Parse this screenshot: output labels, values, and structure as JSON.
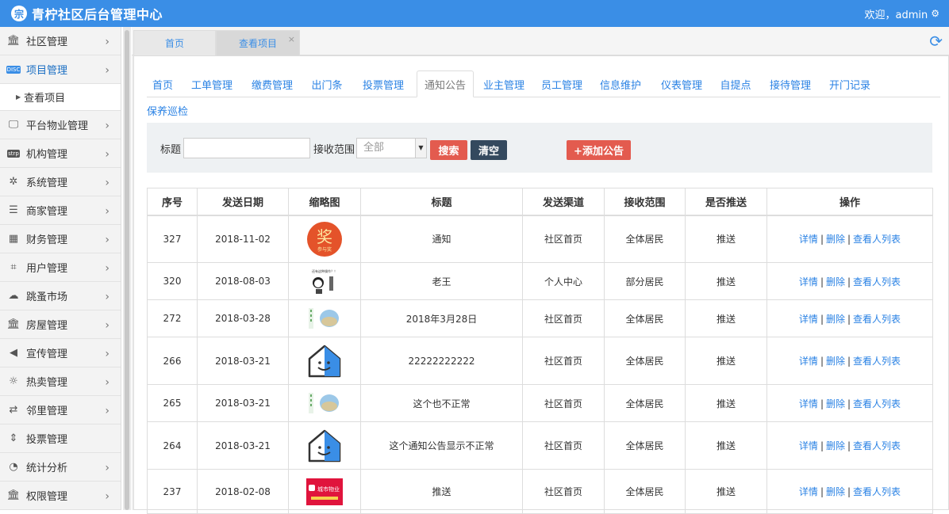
{
  "app": {
    "title": "青柠社区后台管理中心",
    "logo_glyph": "宗",
    "welcome": "欢迎，admin",
    "accent": "#3a8ee6"
  },
  "sidebar": {
    "items": [
      {
        "label": "社区管理",
        "icon": "bank-icon"
      },
      {
        "label": "项目管理",
        "icon": "discover-card-icon"
      },
      {
        "label": "平台物业管理",
        "icon": "monitor-icon"
      },
      {
        "label": "机构管理",
        "icon": "stripe-icon"
      },
      {
        "label": "系统管理",
        "icon": "yelp-icon"
      },
      {
        "label": "商家管理",
        "icon": "list-icon"
      },
      {
        "label": "财务管理",
        "icon": "calculator-icon"
      },
      {
        "label": "用户管理",
        "icon": "crop-icon"
      },
      {
        "label": "跳蚤市场",
        "icon": "cloud-icon"
      },
      {
        "label": "房屋管理",
        "icon": "bank-icon"
      },
      {
        "label": "宣传管理",
        "icon": "volume-icon"
      },
      {
        "label": "热卖管理",
        "icon": "sun-icon"
      },
      {
        "label": "邻里管理",
        "icon": "retweet-icon"
      },
      {
        "label": "投票管理",
        "icon": "sort-icon"
      },
      {
        "label": "统计分析",
        "icon": "pie-chart-icon"
      },
      {
        "label": "权限管理",
        "icon": "bank-icon"
      }
    ],
    "sub_item": "查看项目"
  },
  "tabs": [
    {
      "label": "首页"
    },
    {
      "label": "查看项目"
    }
  ],
  "tab_close": "×",
  "nav": [
    "首页",
    "工单管理",
    "缴费管理",
    "出门条",
    "投票管理",
    "通知公告",
    "业主管理",
    "员工管理",
    "信息维护",
    "仪表管理",
    "自提点",
    "接待管理",
    "开门记录",
    "保养巡检"
  ],
  "nav_active": "通知公告",
  "search": {
    "title_label": "标题",
    "title_value": "",
    "scope_label": "接收范围",
    "scope_value": "全部",
    "search_btn": "搜索",
    "clear_btn": "清空",
    "add_btn": "+添加公告"
  },
  "table": {
    "headers": [
      "序号",
      "发送日期",
      "缩略图",
      "标题",
      "发送渠道",
      "接收范围",
      "是否推送",
      "操作"
    ],
    "actions": [
      "详情",
      "删除",
      "查看人列表"
    ],
    "rows": [
      {
        "id": "327",
        "date": "2018-11-02",
        "thumb": "award-red-circle",
        "title": "通知",
        "channel": "社区首页",
        "scope": "全体居民",
        "push": "推送"
      },
      {
        "id": "320",
        "date": "2018-08-03",
        "thumb": "cartoon-meme",
        "title": "老王",
        "channel": "个人中心",
        "scope": "部分居民",
        "push": "推送"
      },
      {
        "id": "272",
        "date": "2018-03-28",
        "thumb": "poster-photo",
        "title": "2018年3月28日",
        "channel": "社区首页",
        "scope": "全体居民",
        "push": "推送"
      },
      {
        "id": "266",
        "date": "2018-03-21",
        "thumb": "smiling-house",
        "title": "22222222222",
        "channel": "社区首页",
        "scope": "全体居民",
        "push": "推送"
      },
      {
        "id": "265",
        "date": "2018-03-21",
        "thumb": "poster-photo",
        "title": "这个也不正常",
        "channel": "社区首页",
        "scope": "全体居民",
        "push": "推送"
      },
      {
        "id": "264",
        "date": "2018-03-21",
        "thumb": "smiling-house",
        "title": "这个通知公告显示不正常",
        "channel": "社区首页",
        "scope": "全体居民",
        "push": "推送"
      },
      {
        "id": "237",
        "date": "2018-02-08",
        "thumb": "red-banner",
        "title": "推送",
        "channel": "社区首页",
        "scope": "全体居民",
        "push": "推送"
      }
    ]
  },
  "thumb_text": {
    "award": "奖",
    "award_sub": "参与奖",
    "meme": "还有这种操作？！",
    "banner": "城市物业"
  }
}
